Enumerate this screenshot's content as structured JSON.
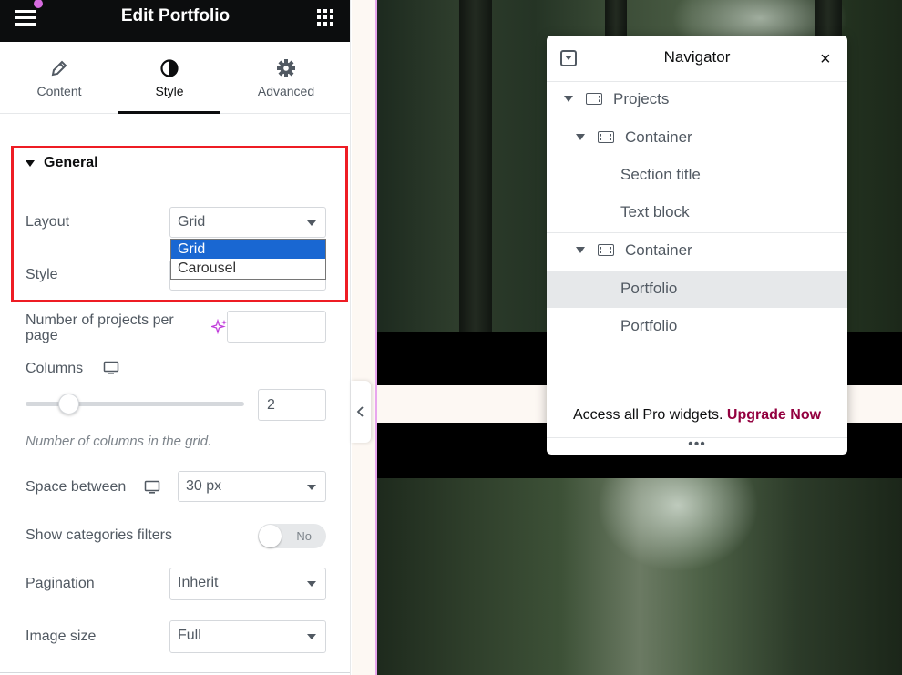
{
  "panel": {
    "title": "Edit Portfolio",
    "tabs": [
      {
        "label": "Content",
        "icon": "pencil-icon"
      },
      {
        "label": "Style",
        "icon": "contrast-icon",
        "active": true
      },
      {
        "label": "Advanced",
        "icon": "gear-icon"
      }
    ],
    "section": {
      "title": "General",
      "layout": {
        "label": "Layout",
        "value": "Grid",
        "options": [
          "Grid",
          "Carousel"
        ],
        "highlighted_option": "Grid"
      },
      "style": {
        "label": "Style"
      }
    },
    "projects_per_page": {
      "label": "Number of projects per page",
      "value": ""
    },
    "columns": {
      "label": "Columns",
      "value": "2",
      "help": "Number of columns in the grid.",
      "slider_fraction": 0.17
    },
    "space_between": {
      "label": "Space between",
      "value": "30 px"
    },
    "show_filters": {
      "label": "Show categories filters",
      "toggle_text": "No",
      "on": false
    },
    "pagination": {
      "label": "Pagination",
      "value": "Inherit"
    },
    "image_size": {
      "label": "Image size",
      "value": "Full"
    }
  },
  "navigator": {
    "title": "Navigator",
    "close": "×",
    "tree": [
      {
        "label": "Projects"
      },
      {
        "label": "Container"
      },
      {
        "label": "Section title"
      },
      {
        "label": "Text block"
      },
      {
        "label": "Container"
      },
      {
        "label": "Portfolio",
        "selected": true
      },
      {
        "label": "Portfolio"
      }
    ],
    "footer_text": "Access all Pro widgets.",
    "upgrade_link": "Upgrade Now",
    "more": "•••"
  },
  "colors": {
    "accent": "#93003f",
    "highlight_border": "#ee1c24",
    "select_highlight": "#1967d2",
    "notification_dot": "#d76bdf"
  }
}
